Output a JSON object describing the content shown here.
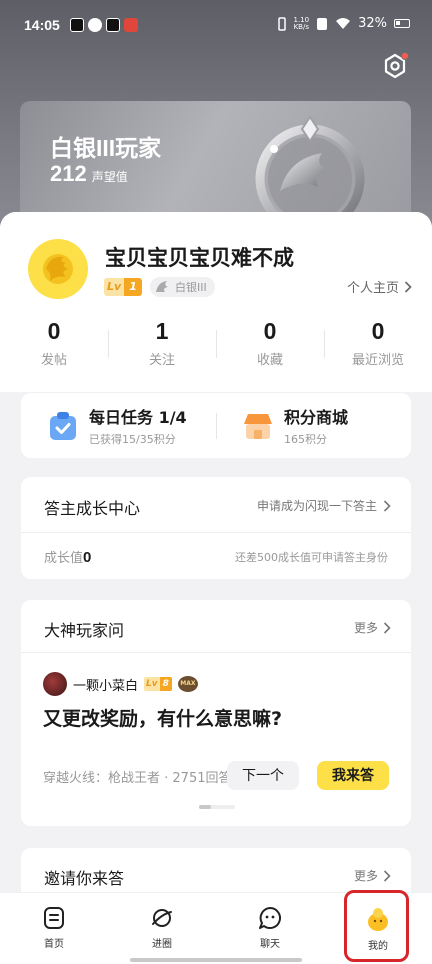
{
  "status_bar": {
    "time": "14:05",
    "net_speed_value": "1.10",
    "net_speed_unit": "KB/s",
    "battery": "32%"
  },
  "rank": {
    "title": "白银III玩家",
    "reputation_value": "212",
    "reputation_label": "声望值"
  },
  "profile": {
    "username": "宝贝宝贝宝贝难不成",
    "level_prefix": "Lv",
    "level": "1",
    "rank_badge": "白银III",
    "homepage_link": "个人主页"
  },
  "stats": [
    {
      "value": "0",
      "label": "发帖"
    },
    {
      "value": "1",
      "label": "关注"
    },
    {
      "value": "0",
      "label": "收藏"
    },
    {
      "value": "0",
      "label": "最近浏览"
    }
  ],
  "tasks": {
    "daily": {
      "title": "每日任务 1/4",
      "subtitle": "已获得15/35积分"
    },
    "shop": {
      "title": "积分商城",
      "subtitle": "165积分"
    }
  },
  "growth": {
    "title": "答主成长中心",
    "apply_link": "申请成为闪现一下答主",
    "label": "成长值",
    "value": "0",
    "hint": "还差500成长值可申请答主身份"
  },
  "qa": {
    "title": "大神玩家问",
    "more": "更多",
    "user": "一颗小菜白",
    "user_level_prefix": "Lv",
    "user_level": "8",
    "user_badge": "MAX",
    "question": "又更改奖励，有什么意思嘛?",
    "meta": "穿越火线：枪战王者 · 2751回答",
    "next_button": "下一个",
    "answer_button": "我来答"
  },
  "invite": {
    "title": "邀请你来答",
    "more": "更多"
  },
  "tabs": [
    {
      "label": "首页",
      "icon": "home-doc-icon",
      "active": false
    },
    {
      "label": "进圈",
      "icon": "planet-icon",
      "active": false
    },
    {
      "label": "聊天",
      "icon": "chat-bubble-icon",
      "active": false
    },
    {
      "label": "我的",
      "icon": "mascot-icon",
      "active": true
    }
  ],
  "colors": {
    "accent_yellow": "#fde047",
    "highlight_red": "#d7262b",
    "level_orange": "#f5a623",
    "notification_red": "#ff5a4f"
  }
}
